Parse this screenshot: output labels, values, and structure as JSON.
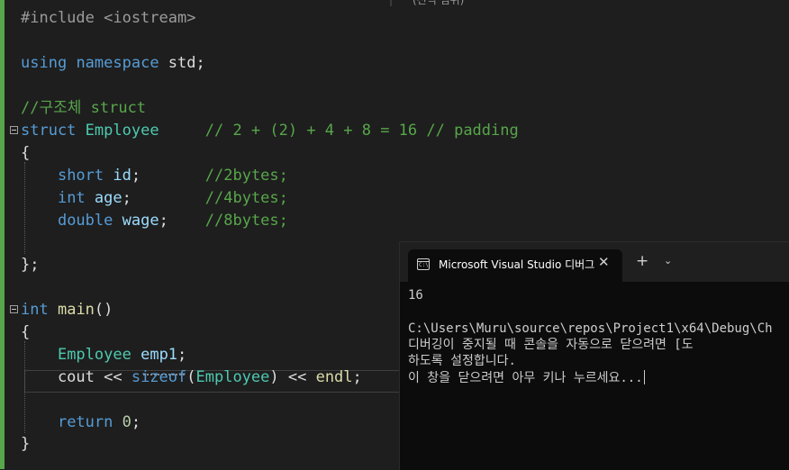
{
  "topbar": {
    "fragment": "(전역 범위)"
  },
  "editor": {
    "lines": {
      "l1": [
        [
          "pp",
          "#include <iostream>"
        ]
      ],
      "l3": [
        [
          "kw",
          "using"
        ],
        [
          "tx",
          " "
        ],
        [
          "kw",
          "namespace"
        ],
        [
          "tx",
          " std;"
        ]
      ],
      "l5": [
        [
          "cm",
          "//구조체 struct"
        ]
      ],
      "l6": [
        [
          "kw",
          "struct"
        ],
        [
          "tx",
          " "
        ],
        [
          "ty",
          "Employee"
        ],
        [
          "tx",
          "     "
        ],
        [
          "cm",
          "// 2 + (2) + 4 + 8 = 16 // padding"
        ]
      ],
      "l7": [
        [
          "br",
          "{"
        ]
      ],
      "l8": [
        [
          "tx",
          "    "
        ],
        [
          "kw",
          "short"
        ],
        [
          "tx",
          " "
        ],
        [
          "id",
          "id"
        ],
        [
          "tx",
          ";       "
        ],
        [
          "cm",
          "//2bytes;"
        ]
      ],
      "l9": [
        [
          "tx",
          "    "
        ],
        [
          "kw",
          "int"
        ],
        [
          "tx",
          " "
        ],
        [
          "id",
          "age"
        ],
        [
          "tx",
          ";        "
        ],
        [
          "cm",
          "//4bytes;"
        ]
      ],
      "l10": [
        [
          "tx",
          "    "
        ],
        [
          "kw",
          "double"
        ],
        [
          "tx",
          " "
        ],
        [
          "id",
          "wage"
        ],
        [
          "tx",
          ";    "
        ],
        [
          "cm",
          "//8bytes;"
        ]
      ],
      "l12": [
        [
          "br",
          "};"
        ]
      ],
      "l14": [
        [
          "kw",
          "int"
        ],
        [
          "tx",
          " "
        ],
        [
          "fn",
          "main"
        ],
        [
          "tx",
          "()"
        ]
      ],
      "l15": [
        [
          "br",
          "{"
        ]
      ],
      "l16": [
        [
          "tx",
          "    "
        ],
        [
          "ty",
          "Employee"
        ],
        [
          "tx",
          " "
        ],
        [
          "id",
          "emp1"
        ],
        [
          "tx",
          ";"
        ]
      ],
      "l17": [
        [
          "tx",
          "    cout << "
        ],
        [
          "kw",
          "sizeof"
        ],
        [
          "tx",
          "("
        ],
        [
          "ty",
          "Employee"
        ],
        [
          "tx",
          ") << "
        ],
        [
          "fn",
          "endl"
        ],
        [
          "tx",
          ";"
        ]
      ],
      "l19": [
        [
          "tx",
          "    "
        ],
        [
          "kw",
          "return"
        ],
        [
          "tx",
          " "
        ],
        [
          "nm",
          "0"
        ],
        [
          "tx",
          ";"
        ]
      ],
      "l20": [
        [
          "br",
          "}"
        ]
      ]
    }
  },
  "console": {
    "tab_title": "Microsoft Visual Studio 디버그",
    "tab_icon_text": "C:\\",
    "close_symbol": "✕",
    "new_tab_symbol": "+",
    "dropdown_symbol": "⌄",
    "output": {
      "result": "16",
      "path": "C:\\Users\\Muru\\source\\repos\\Project1\\x64\\Debug\\Ch",
      "message1": "디버깅이 중지될 때 콘솔을 자동으로 닫으려면 [도",
      "message2": "하도록 설정합니다.",
      "prompt": "이 창을 닫으려면 아무 키나 누르세요..."
    }
  }
}
